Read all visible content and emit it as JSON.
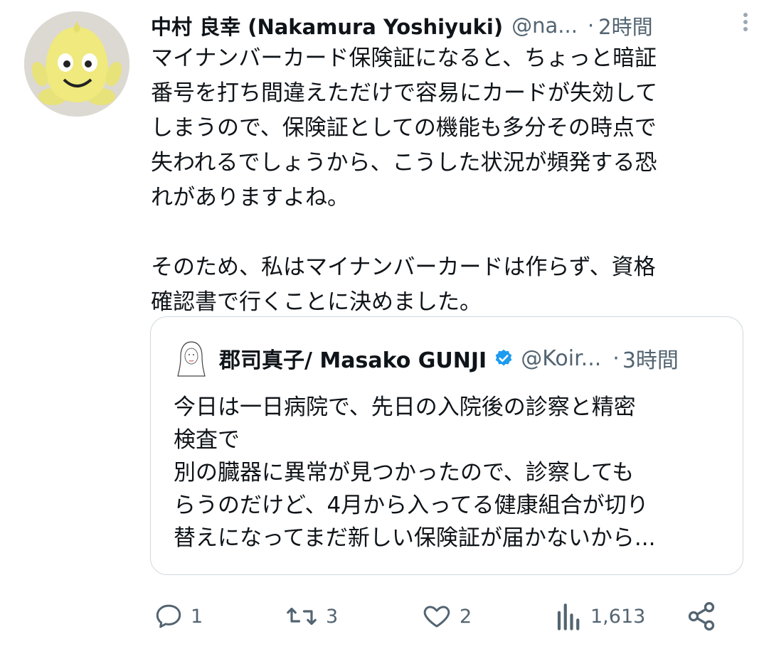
{
  "tweet": {
    "author_name": "中村 良幸 (Nakamura Yoshiyuki)",
    "author_handle": "@na...",
    "separator": "·",
    "time": "2時間",
    "text": "マイナンバーカード保険証になると、ちょっと暗証\n番号を打ち間違えただけで容易にカードが失効して\nしまうので、保険証としての機能も多分その時点で\n失われるでしょうから、こうした状況が頻発する恐\nれがありますよね。\n\nそのため、私はマイナンバーカードは作らず、資格\n確認書で行くことに決めました。"
  },
  "quote": {
    "author_name": "郡司真子/ Masako GUNJI",
    "author_handle": "@Koir...",
    "separator": "·",
    "time": "3時間",
    "verified": true,
    "text": "今日は一日病院で、先日の入院後の診察と精密\n検査で\n別の臓器に異常が見つかったので、診察しても\nらうのだけど、4月から入ってる健康組合が切り\n替えになってまだ新しい保険証が届かないから..."
  },
  "actions": {
    "reply_count": "1",
    "retweet_count": "3",
    "like_count": "2",
    "views_count": "1,613"
  },
  "colors": {
    "text": "#0f1419",
    "muted": "#536471",
    "verified": "#1d9bf0",
    "border": "#cfd9de"
  },
  "icons": {
    "reply": "reply-icon",
    "retweet": "retweet-icon",
    "like": "heart-icon",
    "views": "views-icon",
    "share": "share-icon",
    "more": "more-vertical-icon",
    "verified": "verified-badge-icon"
  }
}
